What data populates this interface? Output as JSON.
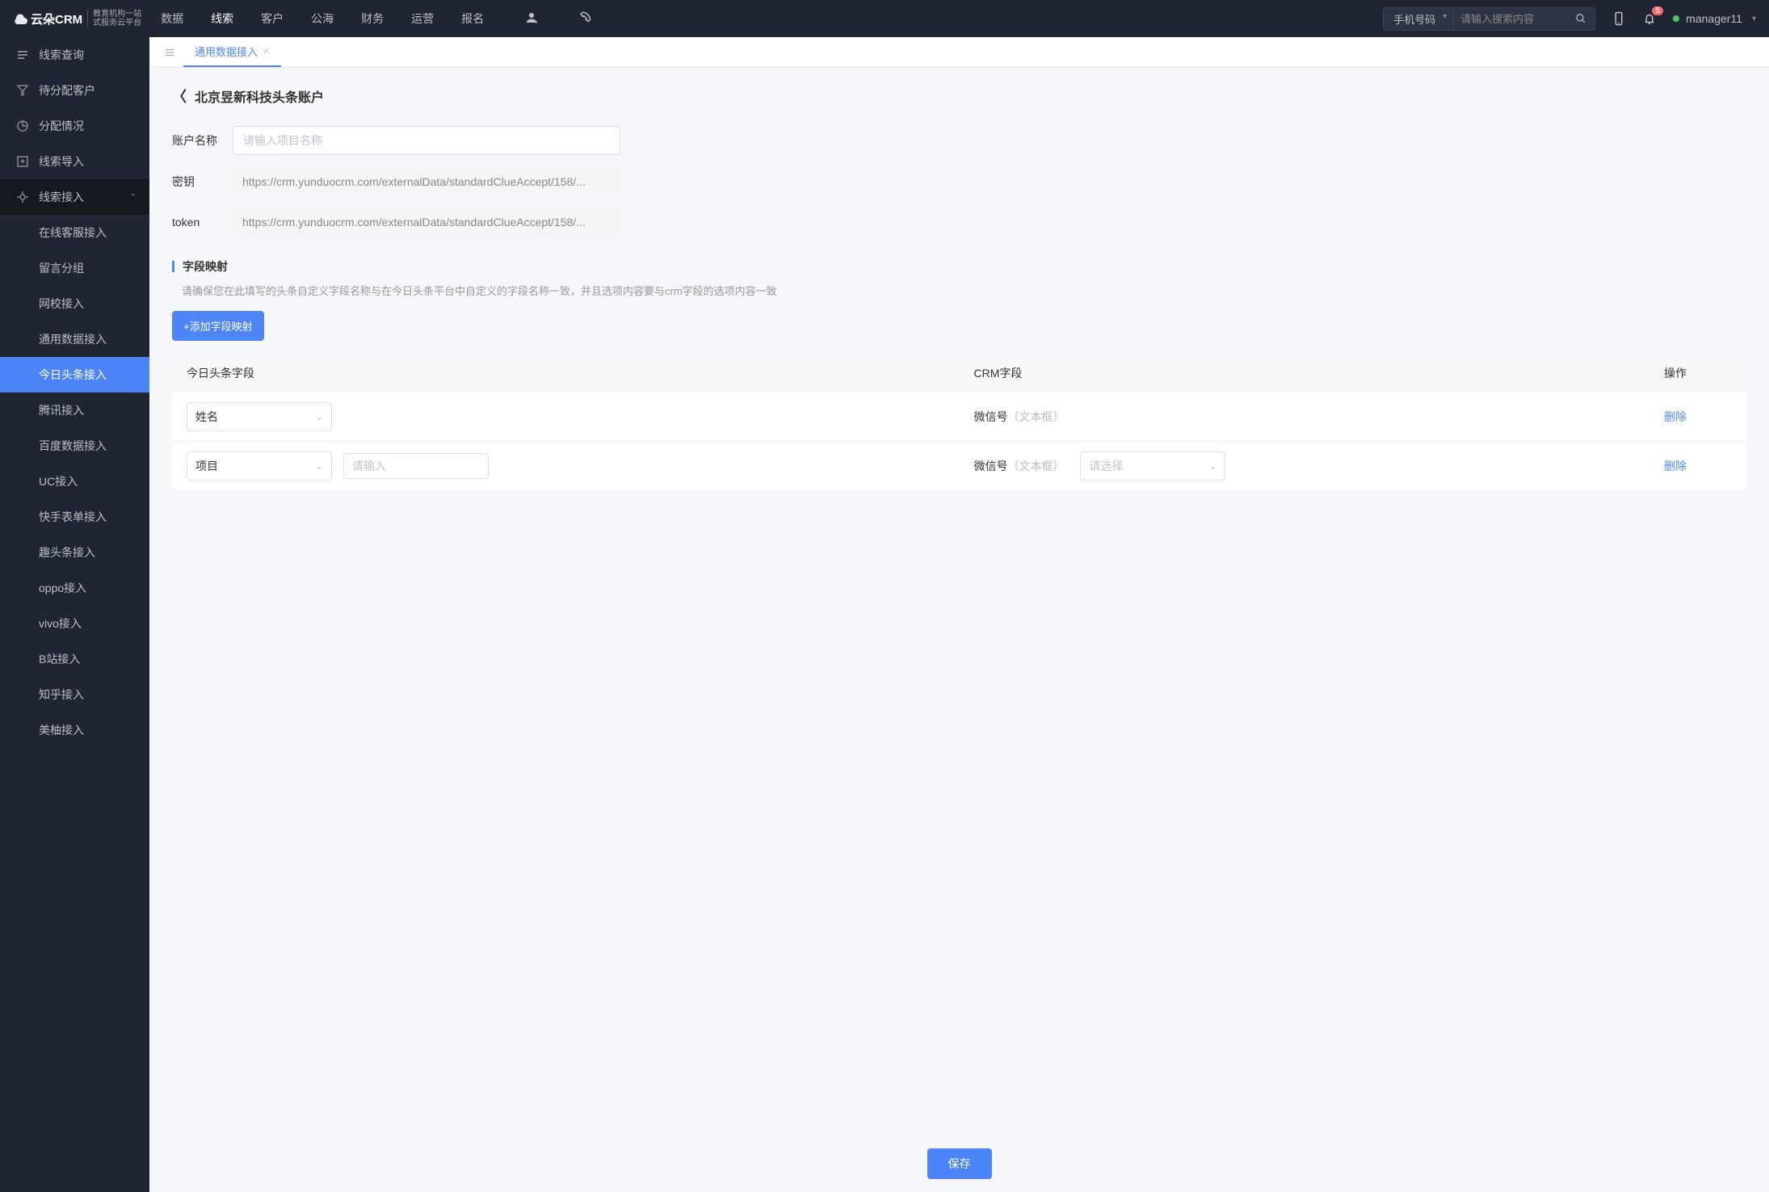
{
  "header": {
    "logo_brand": "云朵CRM",
    "logo_sub1": "教育机构一站",
    "logo_sub2": "式服务云平台",
    "nav": [
      "数据",
      "线索",
      "客户",
      "公海",
      "财务",
      "运营",
      "报名"
    ],
    "nav_active_index": 1,
    "search_type": "手机号码",
    "search_placeholder": "请输入搜索内容",
    "notify_badge": "5",
    "user": "manager11"
  },
  "sidebar": {
    "items": [
      {
        "label": "线索查询"
      },
      {
        "label": "待分配客户"
      },
      {
        "label": "分配情况"
      },
      {
        "label": "线索导入"
      },
      {
        "label": "线索接入",
        "sub": [
          "在线客服接入",
          "留言分组",
          "网校接入",
          "通用数据接入",
          "今日头条接入",
          "腾讯接入",
          "百度数据接入",
          "UC接入",
          "快手表单接入",
          "趣头条接入",
          "oppo接入",
          "vivo接入",
          "B站接入",
          "知乎接入",
          "美柚接入"
        ],
        "active_sub_index": 4
      }
    ]
  },
  "tabs": {
    "active": "通用数据接入"
  },
  "page": {
    "title": "北京昱新科技头条账户",
    "fields": {
      "account_name_label": "账户名称",
      "account_name_placeholder": "请输入项目名称",
      "secret_label": "密钥",
      "secret_value": "https://crm.yunduocrm.com/externalData/standardClueAccept/158/...",
      "token_label": "token",
      "token_value": "https://crm.yunduocrm.com/externalData/standardClueAccept/158/..."
    },
    "mapping": {
      "title": "字段映射",
      "hint": "请确保您在此填写的头条自定义字段名称与在今日头条平台中自定义的字段名称一致，并且选项内容要与crm字段的选项内容一致",
      "add_btn": "+添加字段映射",
      "columns": {
        "c1": "今日头条字段",
        "c2": "CRM字段",
        "c3": "操作"
      },
      "delete_label": "删除",
      "rows": [
        {
          "toutiao_field": "姓名",
          "crm_field_name": "微信号",
          "crm_field_type": "（文本框）"
        },
        {
          "toutiao_field": "项目",
          "extra_input_placeholder": "请输入",
          "crm_field_name": "微信号",
          "crm_field_type": "（文本框）",
          "crm_select_placeholder": "请选择"
        }
      ]
    }
  },
  "footer": {
    "save": "保存"
  }
}
